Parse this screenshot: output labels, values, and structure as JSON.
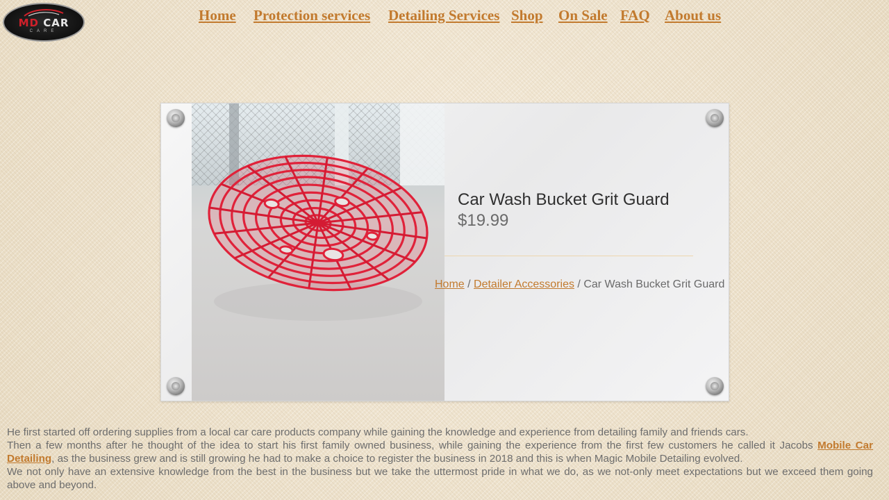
{
  "logo": {
    "md": "MD",
    "car": "CAR",
    "subtitle": "CARE"
  },
  "nav": {
    "items": [
      "Home",
      "Protection services",
      "Detailing Services",
      "Shop",
      "On Sale",
      "FAQ",
      "About us"
    ]
  },
  "product": {
    "title": "Car Wash Bucket Grit Guard",
    "price": "$19.99",
    "breadcrumb": {
      "home": "Home",
      "sep": " / ",
      "category": "Detailer Accessories",
      "current": "Car Wash Bucket Grit Guard"
    }
  },
  "about": {
    "p1": "He first started off ordering supplies from a local car care products company while gaining the knowledge and experience from detailing family and friends cars.",
    "p2_before": "Then a few months after he thought of the idea to start his first family owned business, while gaining the experience from the first few customers he called it Jacobs ",
    "p2_link": "Mobile Car Detailing",
    "p2_after": ", as the business grew and is still growing he had to make a choice to register the business in 2018 and this is when Magic Mobile Detailing evolved.",
    "p3": "We not only have an extensive knowledge from the best in the business but we take the uttermost pride in what we do, as we not-only meet expectations but we exceed them going above and beyond."
  },
  "colors": {
    "accent": "#c27a2e",
    "text": "#6d6d6d",
    "product_red": "#e0223a"
  }
}
